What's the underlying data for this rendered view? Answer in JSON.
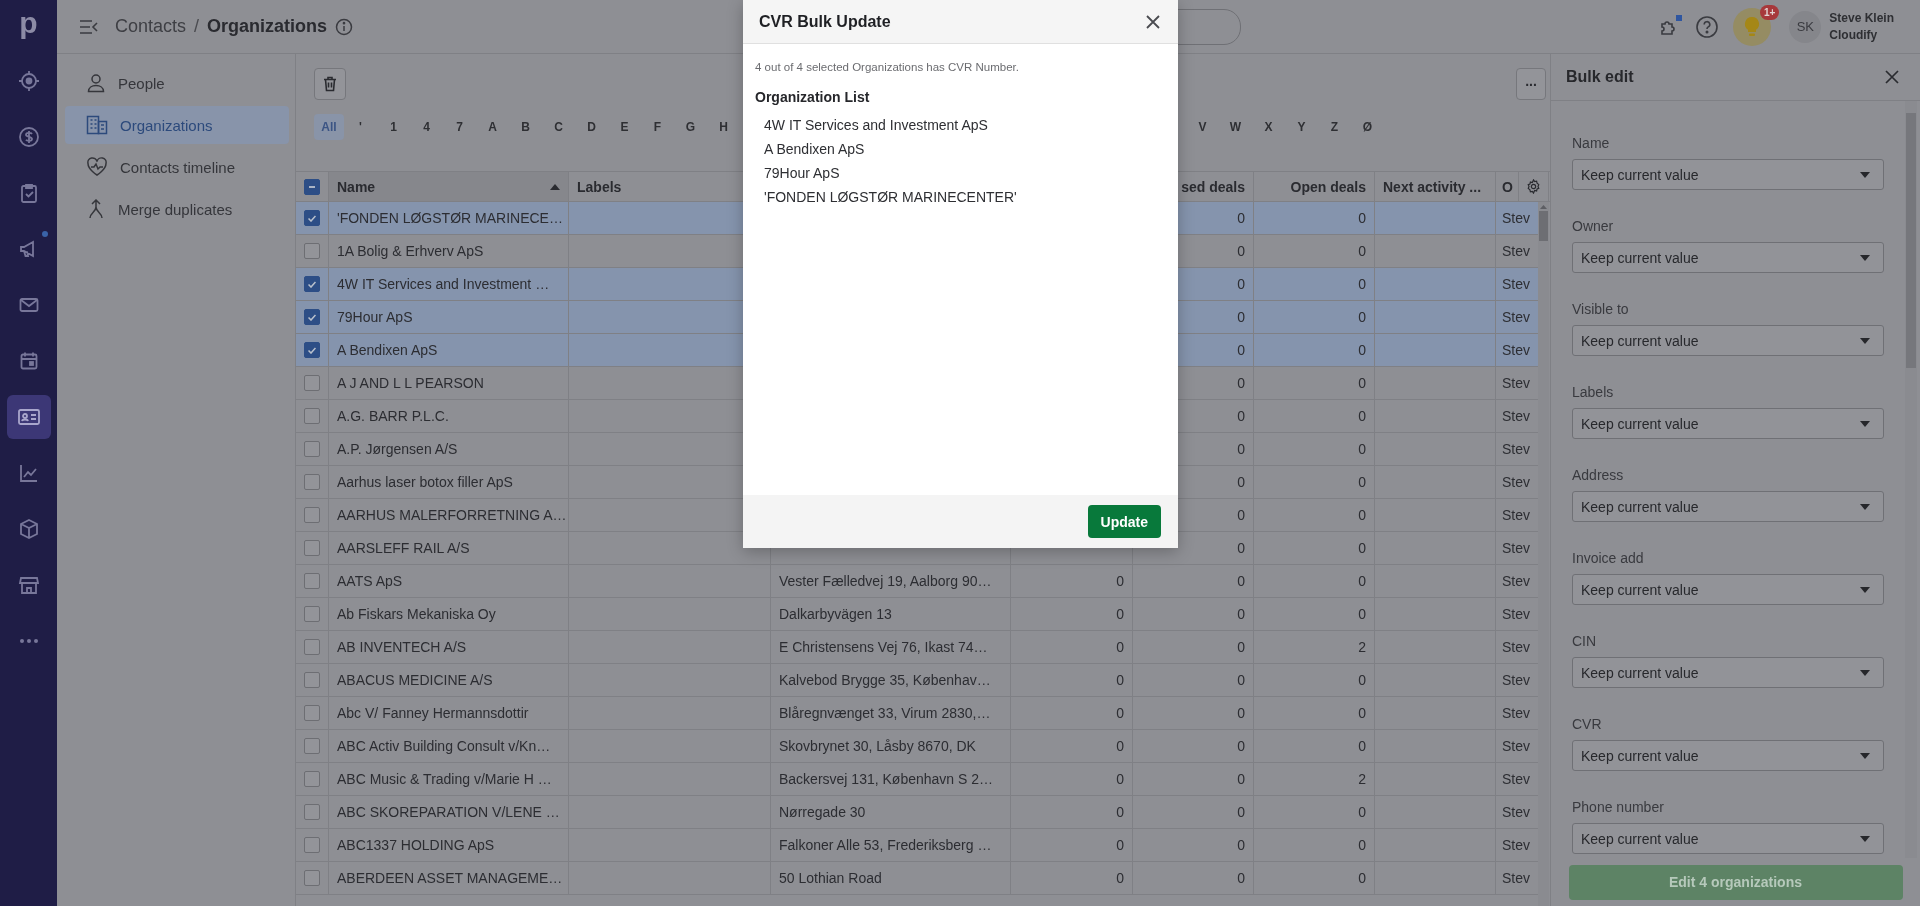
{
  "rail": {
    "logo": "p",
    "items": [
      {
        "selected": false,
        "dot": false
      },
      {
        "selected": false,
        "dot": false
      },
      {
        "selected": false,
        "dot": false
      },
      {
        "selected": false,
        "dot": true
      },
      {
        "selected": false,
        "dot": false
      },
      {
        "selected": false,
        "dot": false
      },
      {
        "selected": true,
        "dot": false
      },
      {
        "selected": false,
        "dot": false
      },
      {
        "selected": false,
        "dot": false
      },
      {
        "selected": false,
        "dot": false
      },
      {
        "selected": false,
        "dot": false
      }
    ]
  },
  "topbar": {
    "breadcrumb": {
      "parent": "Contacts",
      "separator": "/",
      "current": "Organizations"
    },
    "icons": [
      {
        "dot": true
      },
      {
        "dot": false
      }
    ],
    "tips_badge": "1+",
    "user": {
      "initials": "SK",
      "name": "Steve Klein",
      "company": "Cloudify"
    }
  },
  "sidebar": {
    "items": [
      {
        "label": "People",
        "selected": false
      },
      {
        "label": "Organizations",
        "selected": true
      },
      {
        "label": "Contacts timeline",
        "selected": false
      },
      {
        "label": "Merge duplicates",
        "selected": false
      }
    ]
  },
  "toolbar": {
    "more": "..."
  },
  "alphabet_filter": {
    "visible_before_dialog": [
      {
        "label": "All",
        "selected": true
      },
      {
        "label": "'",
        "selected": false
      },
      {
        "label": "1",
        "selected": false
      },
      {
        "label": "4",
        "selected": false
      },
      {
        "label": "7",
        "selected": false
      },
      {
        "label": "A",
        "selected": false
      },
      {
        "label": "B",
        "selected": false
      },
      {
        "label": "C",
        "selected": false
      },
      {
        "label": "D",
        "selected": false
      },
      {
        "label": "E",
        "selected": false
      },
      {
        "label": "F",
        "selected": false
      },
      {
        "label": "G",
        "selected": false
      },
      {
        "label": "H",
        "selected": false
      }
    ],
    "visible_after_dialog": [
      {
        "label": "V",
        "selected": false
      },
      {
        "label": "W",
        "selected": false
      },
      {
        "label": "X",
        "selected": false
      },
      {
        "label": "Y",
        "selected": false
      },
      {
        "label": "Z",
        "selected": false
      },
      {
        "label": "Ø",
        "selected": false
      }
    ]
  },
  "table": {
    "header": {
      "select_all_partial": true,
      "name": "Name",
      "name_sorted_ascending": true,
      "labels": "Labels",
      "closed_deals": "sed deals",
      "open_deals": "Open deals",
      "next_activity": "Next activity ...",
      "owner": "O"
    },
    "rows": [
      {
        "selected": true,
        "name": "'FONDEN LØGSTØR MARINECE…",
        "closed_deals": "0",
        "open_deals": "0",
        "owner": "Stev"
      },
      {
        "selected": false,
        "name": "1A Bolig & Erhverv ApS",
        "closed_deals": "0",
        "open_deals": "0",
        "owner": "Stev"
      },
      {
        "selected": true,
        "name": "4W IT Services and Investment …",
        "closed_deals": "0",
        "open_deals": "0",
        "owner": "Stev"
      },
      {
        "selected": true,
        "name": "79Hour ApS",
        "closed_deals": "0",
        "open_deals": "0",
        "owner": "Stev"
      },
      {
        "selected": true,
        "name": "A Bendixen ApS",
        "closed_deals": "0",
        "open_deals": "0",
        "owner": "Stev"
      },
      {
        "selected": false,
        "name": "A J AND L L PEARSON",
        "closed_deals": "0",
        "open_deals": "0",
        "owner": "Stev"
      },
      {
        "selected": false,
        "name": "A.G. BARR P.L.C.",
        "closed_deals": "0",
        "open_deals": "0",
        "owner": "Stev"
      },
      {
        "selected": false,
        "name": "A.P. Jørgensen A/S",
        "closed_deals": "0",
        "open_deals": "0",
        "owner": "Stev"
      },
      {
        "selected": false,
        "name": "Aarhus laser botox filler ApS",
        "closed_deals": "0",
        "open_deals": "0",
        "owner": "Stev"
      },
      {
        "selected": false,
        "name": "AARHUS MALERFORRETNING A…",
        "closed_deals": "0",
        "open_deals": "0",
        "owner": "Stev"
      },
      {
        "selected": false,
        "name": "AARSLEFF RAIL A/S",
        "closed_deals": "0",
        "open_deals": "0",
        "owner": "Stev"
      },
      {
        "selected": false,
        "name": "AATS ApS",
        "address": "Vester Fælledvej 19, Aalborg 90…",
        "column_5": "0",
        "closed_deals": "0",
        "open_deals": "0",
        "owner": "Stev"
      },
      {
        "selected": false,
        "name": "Ab Fiskars Mekaniska Oy",
        "address": "Dalkarbyvägen 13",
        "column_5": "0",
        "closed_deals": "0",
        "open_deals": "0",
        "owner": "Stev"
      },
      {
        "selected": false,
        "name": "AB INVENTECH A/S",
        "address": "E Christensens Vej 76, Ikast 74…",
        "column_5": "0",
        "closed_deals": "0",
        "open_deals": "2",
        "owner": "Stev"
      },
      {
        "selected": false,
        "name": "ABACUS MEDICINE A/S",
        "address": "Kalvebod Brygge 35, Københav…",
        "column_5": "0",
        "closed_deals": "0",
        "open_deals": "0",
        "owner": "Stev"
      },
      {
        "selected": false,
        "name": "Abc V/ Fanney Hermannsdottir",
        "address": "Blåregnvænget 33, Virum 2830,…",
        "column_5": "0",
        "closed_deals": "0",
        "open_deals": "0",
        "owner": "Stev"
      },
      {
        "selected": false,
        "name": "ABC Activ Building Consult v/Kn…",
        "address": "Skovbrynet 30, Låsby 8670, DK",
        "column_5": "0",
        "closed_deals": "0",
        "open_deals": "0",
        "owner": "Stev"
      },
      {
        "selected": false,
        "name": "ABC Music & Trading v/Marie H …",
        "address": "Backersvej 131, København S 2…",
        "column_5": "0",
        "closed_deals": "0",
        "open_deals": "2",
        "owner": "Stev"
      },
      {
        "selected": false,
        "name": "ABC SKOREPARATION V/LENE …",
        "address": "Nørregade 30",
        "column_5": "0",
        "closed_deals": "0",
        "open_deals": "0",
        "owner": "Stev"
      },
      {
        "selected": false,
        "name": "ABC1337 HOLDING ApS",
        "address": "Falkoner Alle 53, Frederiksberg …",
        "column_5": "0",
        "closed_deals": "0",
        "open_deals": "0",
        "owner": "Stev"
      },
      {
        "selected": false,
        "name": "ABERDEEN ASSET MANAGEME…",
        "address": "50 Lothian Road",
        "column_5": "0",
        "closed_deals": "0",
        "open_deals": "0",
        "owner": "Stev"
      }
    ]
  },
  "dialog": {
    "title": "CVR Bulk Update",
    "summary": "4 out of 4 selected Organizations has CVR Number.",
    "list_title": "Organization List",
    "organizations": [
      "4W IT Services and Investment ApS",
      "A Bendixen ApS",
      "79Hour ApS",
      "'FONDEN LØGSTØR MARINECENTER'"
    ],
    "button": "Update"
  },
  "bulk_edit": {
    "title": "Bulk edit",
    "fields": [
      {
        "label": "Name",
        "value": "Keep current value"
      },
      {
        "label": "Owner",
        "value": "Keep current value"
      },
      {
        "label": "Visible to",
        "value": "Keep current value"
      },
      {
        "label": "Labels",
        "value": "Keep current value"
      },
      {
        "label": "Address",
        "value": "Keep current value"
      },
      {
        "label": "Invoice add",
        "value": "Keep current value"
      },
      {
        "label": "CIN",
        "value": "Keep current value"
      },
      {
        "label": "CVR",
        "value": "Keep current value"
      },
      {
        "label": "Phone number",
        "value": "Keep current value"
      }
    ],
    "button": "Edit 4 organizations"
  }
}
